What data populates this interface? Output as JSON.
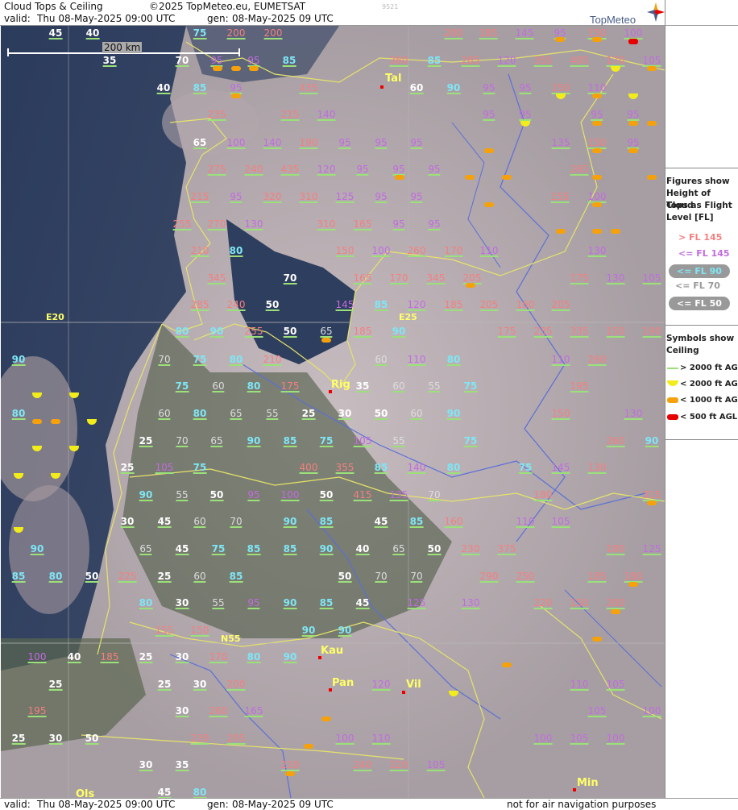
{
  "header": {
    "title": "Cloud Tops & Ceiling",
    "copyright": "©2025 TopMeteo.eu, EUMETSAT",
    "code": "9521",
    "valid_label": "valid:",
    "valid_value": "Thu  08-May-2025  09:00 UTC",
    "gen_label": "gen:",
    "gen_value": "08-May-2025 09 UTC",
    "logo": "TopMeteo"
  },
  "scale": {
    "label": "200 km"
  },
  "grid_labels": {
    "lon1": "E20",
    "lon2": "E25",
    "lat1": "N55"
  },
  "places": [
    {
      "name": "Tal"
    },
    {
      "name": "Rig"
    },
    {
      "name": "Kau"
    },
    {
      "name": "Pan"
    },
    {
      "name": "Vil"
    },
    {
      "name": "Min"
    },
    {
      "name": "Ols"
    }
  ],
  "legend": {
    "tops_title": [
      "Figures show",
      "Height of Cloud",
      "Tops as Flight",
      "Level  [FL]"
    ],
    "tops_items": [
      {
        "label": "> FL 145",
        "color": "#f57f7f",
        "pill": false
      },
      {
        "label": "<= FL 145",
        "color": "#c26be0",
        "pill": false
      },
      {
        "label": "<= FL 90",
        "color": "#7fe6f5",
        "pill": true
      },
      {
        "label": "<= FL 70",
        "color": "#dddddd",
        "pill": false
      },
      {
        "label": "<= FL 50",
        "color": "#ffffff",
        "pill": true
      }
    ],
    "ceiling_title": [
      "Symbols show",
      "Ceiling"
    ],
    "ceiling_items": [
      {
        "label": "> 2000 ft AGL",
        "color": "#9be07a",
        "shape": "line"
      },
      {
        "label": "< 2000 ft AGL",
        "color": "#f2ec1b",
        "shape": "half"
      },
      {
        "label": "< 1000 ft AGL",
        "color": "#f5a10c",
        "shape": "bar"
      },
      {
        "label": "<  500 ft AGL",
        "color": "#e60000",
        "shape": "bar"
      }
    ]
  },
  "footer": {
    "valid_label": "valid:",
    "valid_value": "Thu  08-May-2025  09:00 UTC",
    "gen_label": "gen:",
    "gen_value": "08-May-2025 09 UTC",
    "disclaimer": "not for air navigation purposes"
  },
  "tops": [
    {
      "v": "45",
      "c": "w"
    },
    {
      "v": "40",
      "c": "w"
    },
    {
      "v": "75",
      "c": "c"
    },
    {
      "v": "200",
      "c": "r"
    },
    {
      "v": "200",
      "c": "r"
    },
    {
      "v": "200",
      "c": "r"
    },
    {
      "v": "185",
      "c": "r"
    },
    {
      "v": "145",
      "c": "p"
    },
    {
      "v": "95",
      "c": "p"
    },
    {
      "v": "150",
      "c": "r"
    },
    {
      "v": "100",
      "c": "p"
    },
    {
      "v": "35",
      "c": "w"
    },
    {
      "v": "70",
      "c": "w"
    },
    {
      "v": "95",
      "c": "p"
    },
    {
      "v": "95",
      "c": "p"
    },
    {
      "v": "85",
      "c": "c"
    },
    {
      "v": "380",
      "c": "r"
    },
    {
      "v": "85",
      "c": "c"
    },
    {
      "v": "285",
      "c": "r"
    },
    {
      "v": "120",
      "c": "p"
    },
    {
      "v": "355",
      "c": "r"
    },
    {
      "v": "405",
      "c": "r"
    },
    {
      "v": "170",
      "c": "r"
    },
    {
      "v": "105",
      "c": "p"
    },
    {
      "v": "40",
      "c": "w"
    },
    {
      "v": "85",
      "c": "c"
    },
    {
      "v": "95",
      "c": "p"
    },
    {
      "v": "435",
      "c": "r"
    },
    {
      "v": "60",
      "c": "w"
    },
    {
      "v": "90",
      "c": "c"
    },
    {
      "v": "95",
      "c": "p"
    },
    {
      "v": "95",
      "c": "p"
    },
    {
      "v": "150",
      "c": "r"
    },
    {
      "v": "110",
      "c": "p"
    },
    {
      "v": "235",
      "c": "r"
    },
    {
      "v": "215",
      "c": "r"
    },
    {
      "v": "140",
      "c": "p"
    },
    {
      "v": "95",
      "c": "p"
    },
    {
      "v": "95",
      "c": "p"
    },
    {
      "v": "95",
      "c": "p"
    },
    {
      "v": "95",
      "c": "p"
    },
    {
      "v": "65",
      "c": "w"
    },
    {
      "v": "100",
      "c": "p"
    },
    {
      "v": "140",
      "c": "p"
    },
    {
      "v": "190",
      "c": "r"
    },
    {
      "v": "95",
      "c": "p"
    },
    {
      "v": "95",
      "c": "p"
    },
    {
      "v": "95",
      "c": "p"
    },
    {
      "v": "135",
      "c": "p"
    },
    {
      "v": "150",
      "c": "r"
    },
    {
      "v": "95",
      "c": "p"
    },
    {
      "v": "275",
      "c": "r"
    },
    {
      "v": "240",
      "c": "r"
    },
    {
      "v": "435",
      "c": "r"
    },
    {
      "v": "120",
      "c": "p"
    },
    {
      "v": "95",
      "c": "p"
    },
    {
      "v": "95",
      "c": "p"
    },
    {
      "v": "95",
      "c": "p"
    },
    {
      "v": "265",
      "c": "r"
    },
    {
      "v": "215",
      "c": "r"
    },
    {
      "v": "95",
      "c": "p"
    },
    {
      "v": "320",
      "c": "r"
    },
    {
      "v": "310",
      "c": "r"
    },
    {
      "v": "125",
      "c": "p"
    },
    {
      "v": "95",
      "c": "p"
    },
    {
      "v": "95",
      "c": "p"
    },
    {
      "v": "155",
      "c": "r"
    },
    {
      "v": "100",
      "c": "p"
    },
    {
      "v": "255",
      "c": "r"
    },
    {
      "v": "270",
      "c": "r"
    },
    {
      "v": "130",
      "c": "p"
    },
    {
      "v": "310",
      "c": "r"
    },
    {
      "v": "165",
      "c": "r"
    },
    {
      "v": "95",
      "c": "p"
    },
    {
      "v": "95",
      "c": "p"
    },
    {
      "v": "210",
      "c": "r"
    },
    {
      "v": "80",
      "c": "c"
    },
    {
      "v": "150",
      "c": "r"
    },
    {
      "v": "100",
      "c": "p"
    },
    {
      "v": "260",
      "c": "r"
    },
    {
      "v": "170",
      "c": "r"
    },
    {
      "v": "110",
      "c": "p"
    },
    {
      "v": "130",
      "c": "p"
    },
    {
      "v": "345",
      "c": "r"
    },
    {
      "v": "70",
      "c": "w"
    },
    {
      "v": "165",
      "c": "r"
    },
    {
      "v": "170",
      "c": "r"
    },
    {
      "v": "345",
      "c": "r"
    },
    {
      "v": "205",
      "c": "r"
    },
    {
      "v": "175",
      "c": "r"
    },
    {
      "v": "130",
      "c": "p"
    },
    {
      "v": "105",
      "c": "p"
    },
    {
      "v": "285",
      "c": "r"
    },
    {
      "v": "240",
      "c": "r"
    },
    {
      "v": "50",
      "c": "w"
    },
    {
      "v": "145",
      "c": "p"
    },
    {
      "v": "85",
      "c": "c"
    },
    {
      "v": "120",
      "c": "p"
    },
    {
      "v": "185",
      "c": "r"
    },
    {
      "v": "205",
      "c": "r"
    },
    {
      "v": "160",
      "c": "r"
    },
    {
      "v": "205",
      "c": "r"
    },
    {
      "v": "80",
      "c": "c"
    },
    {
      "v": "90",
      "c": "c"
    },
    {
      "v": "255",
      "c": "r"
    },
    {
      "v": "50",
      "c": "w"
    },
    {
      "v": "65",
      "c": "g"
    },
    {
      "v": "185",
      "c": "r"
    },
    {
      "v": "90",
      "c": "c"
    },
    {
      "v": "175",
      "c": "r"
    },
    {
      "v": "235",
      "c": "r"
    },
    {
      "v": "335",
      "c": "r"
    },
    {
      "v": "150",
      "c": "r"
    },
    {
      "v": "190",
      "c": "r"
    },
    {
      "v": "90",
      "c": "c"
    },
    {
      "v": "70",
      "c": "g"
    },
    {
      "v": "75",
      "c": "c"
    },
    {
      "v": "80",
      "c": "c"
    },
    {
      "v": "210",
      "c": "r"
    },
    {
      "v": "60",
      "c": "g"
    },
    {
      "v": "110",
      "c": "p"
    },
    {
      "v": "80",
      "c": "c"
    },
    {
      "v": "110",
      "c": "p"
    },
    {
      "v": "260",
      "c": "r"
    },
    {
      "v": "75",
      "c": "c"
    },
    {
      "v": "60",
      "c": "g"
    },
    {
      "v": "80",
      "c": "c"
    },
    {
      "v": "175",
      "c": "r"
    },
    {
      "v": "35",
      "c": "w"
    },
    {
      "v": "60",
      "c": "g"
    },
    {
      "v": "55",
      "c": "g"
    },
    {
      "v": "75",
      "c": "c"
    },
    {
      "v": "195",
      "c": "r"
    },
    {
      "v": "80",
      "c": "c"
    },
    {
      "v": "60",
      "c": "g"
    },
    {
      "v": "80",
      "c": "c"
    },
    {
      "v": "65",
      "c": "g"
    },
    {
      "v": "55",
      "c": "g"
    },
    {
      "v": "25",
      "c": "w"
    },
    {
      "v": "30",
      "c": "w"
    },
    {
      "v": "50",
      "c": "w"
    },
    {
      "v": "60",
      "c": "g"
    },
    {
      "v": "90",
      "c": "c"
    },
    {
      "v": "150",
      "c": "r"
    },
    {
      "v": "130",
      "c": "p"
    },
    {
      "v": "25",
      "c": "w"
    },
    {
      "v": "70",
      "c": "g"
    },
    {
      "v": "65",
      "c": "g"
    },
    {
      "v": "90",
      "c": "c"
    },
    {
      "v": "85",
      "c": "c"
    },
    {
      "v": "75",
      "c": "c"
    },
    {
      "v": "105",
      "c": "p"
    },
    {
      "v": "55",
      "c": "g"
    },
    {
      "v": "75",
      "c": "c"
    },
    {
      "v": "260",
      "c": "r"
    },
    {
      "v": "90",
      "c": "c"
    },
    {
      "v": "25",
      "c": "w"
    },
    {
      "v": "105",
      "c": "p"
    },
    {
      "v": "75",
      "c": "c"
    },
    {
      "v": "400",
      "c": "r"
    },
    {
      "v": "355",
      "c": "r"
    },
    {
      "v": "85",
      "c": "c"
    },
    {
      "v": "140",
      "c": "p"
    },
    {
      "v": "80",
      "c": "c"
    },
    {
      "v": "75",
      "c": "c"
    },
    {
      "v": "145",
      "c": "p"
    },
    {
      "v": "130",
      "c": "r"
    },
    {
      "v": "90",
      "c": "c"
    },
    {
      "v": "55",
      "c": "g"
    },
    {
      "v": "50",
      "c": "w"
    },
    {
      "v": "95",
      "c": "p"
    },
    {
      "v": "100",
      "c": "p"
    },
    {
      "v": "50",
      "c": "w"
    },
    {
      "v": "415",
      "c": "r"
    },
    {
      "v": "135",
      "c": "p"
    },
    {
      "v": "70",
      "c": "g"
    },
    {
      "v": "180",
      "c": "r"
    },
    {
      "v": "315",
      "c": "r"
    },
    {
      "v": "30",
      "c": "w"
    },
    {
      "v": "45",
      "c": "w"
    },
    {
      "v": "60",
      "c": "g"
    },
    {
      "v": "70",
      "c": "g"
    },
    {
      "v": "90",
      "c": "c"
    },
    {
      "v": "85",
      "c": "c"
    },
    {
      "v": "45",
      "c": "w"
    },
    {
      "v": "85",
      "c": "c"
    },
    {
      "v": "160",
      "c": "r"
    },
    {
      "v": "110",
      "c": "p"
    },
    {
      "v": "105",
      "c": "p"
    },
    {
      "v": "90",
      "c": "c"
    },
    {
      "v": "65",
      "c": "g"
    },
    {
      "v": "45",
      "c": "w"
    },
    {
      "v": "75",
      "c": "c"
    },
    {
      "v": "85",
      "c": "c"
    },
    {
      "v": "85",
      "c": "c"
    },
    {
      "v": "90",
      "c": "c"
    },
    {
      "v": "40",
      "c": "w"
    },
    {
      "v": "65",
      "c": "g"
    },
    {
      "v": "50",
      "c": "w"
    },
    {
      "v": "230",
      "c": "r"
    },
    {
      "v": "375",
      "c": "r"
    },
    {
      "v": "180",
      "c": "r"
    },
    {
      "v": "125",
      "c": "p"
    },
    {
      "v": "85",
      "c": "c"
    },
    {
      "v": "80",
      "c": "c"
    },
    {
      "v": "50",
      "c": "w"
    },
    {
      "v": "225",
      "c": "r"
    },
    {
      "v": "25",
      "c": "w"
    },
    {
      "v": "60",
      "c": "g"
    },
    {
      "v": "85",
      "c": "c"
    },
    {
      "v": "50",
      "c": "w"
    },
    {
      "v": "70",
      "c": "g"
    },
    {
      "v": "70",
      "c": "g"
    },
    {
      "v": "290",
      "c": "r"
    },
    {
      "v": "250",
      "c": "r"
    },
    {
      "v": "185",
      "c": "r"
    },
    {
      "v": "180",
      "c": "r"
    },
    {
      "v": "80",
      "c": "c"
    },
    {
      "v": "30",
      "c": "w"
    },
    {
      "v": "55",
      "c": "g"
    },
    {
      "v": "95",
      "c": "p"
    },
    {
      "v": "90",
      "c": "c"
    },
    {
      "v": "85",
      "c": "c"
    },
    {
      "v": "45",
      "c": "w"
    },
    {
      "v": "125",
      "c": "p"
    },
    {
      "v": "130",
      "c": "p"
    },
    {
      "v": "220",
      "c": "r"
    },
    {
      "v": "150",
      "c": "r"
    },
    {
      "v": "200",
      "c": "r"
    },
    {
      "v": "155",
      "c": "r"
    },
    {
      "v": "150",
      "c": "r"
    },
    {
      "v": "90",
      "c": "c"
    },
    {
      "v": "90",
      "c": "c"
    },
    {
      "v": "100",
      "c": "p"
    },
    {
      "v": "40",
      "c": "w"
    },
    {
      "v": "185",
      "c": "r"
    },
    {
      "v": "25",
      "c": "w"
    },
    {
      "v": "30",
      "c": "w"
    },
    {
      "v": "170",
      "c": "r"
    },
    {
      "v": "80",
      "c": "c"
    },
    {
      "v": "90",
      "c": "c"
    },
    {
      "v": "25",
      "c": "w"
    },
    {
      "v": "25",
      "c": "w"
    },
    {
      "v": "30",
      "c": "w"
    },
    {
      "v": "200",
      "c": "r"
    },
    {
      "v": "120",
      "c": "p"
    },
    {
      "v": "110",
      "c": "p"
    },
    {
      "v": "105",
      "c": "p"
    },
    {
      "v": "195",
      "c": "r"
    },
    {
      "v": "30",
      "c": "w"
    },
    {
      "v": "260",
      "c": "r"
    },
    {
      "v": "165",
      "c": "p"
    },
    {
      "v": "105",
      "c": "p"
    },
    {
      "v": "100",
      "c": "p"
    },
    {
      "v": "25",
      "c": "w"
    },
    {
      "v": "30",
      "c": "w"
    },
    {
      "v": "50",
      "c": "w"
    },
    {
      "v": "230",
      "c": "r"
    },
    {
      "v": "205",
      "c": "r"
    },
    {
      "v": "100",
      "c": "p"
    },
    {
      "v": "110",
      "c": "p"
    },
    {
      "v": "100",
      "c": "p"
    },
    {
      "v": "105",
      "c": "p"
    },
    {
      "v": "100",
      "c": "p"
    },
    {
      "v": "30",
      "c": "w"
    },
    {
      "v": "35",
      "c": "w"
    },
    {
      "v": "210",
      "c": "r"
    },
    {
      "v": "240",
      "c": "r"
    },
    {
      "v": "220",
      "c": "r"
    },
    {
      "v": "105",
      "c": "p"
    },
    {
      "v": "45",
      "c": "w"
    },
    {
      "v": "80",
      "c": "c"
    }
  ]
}
